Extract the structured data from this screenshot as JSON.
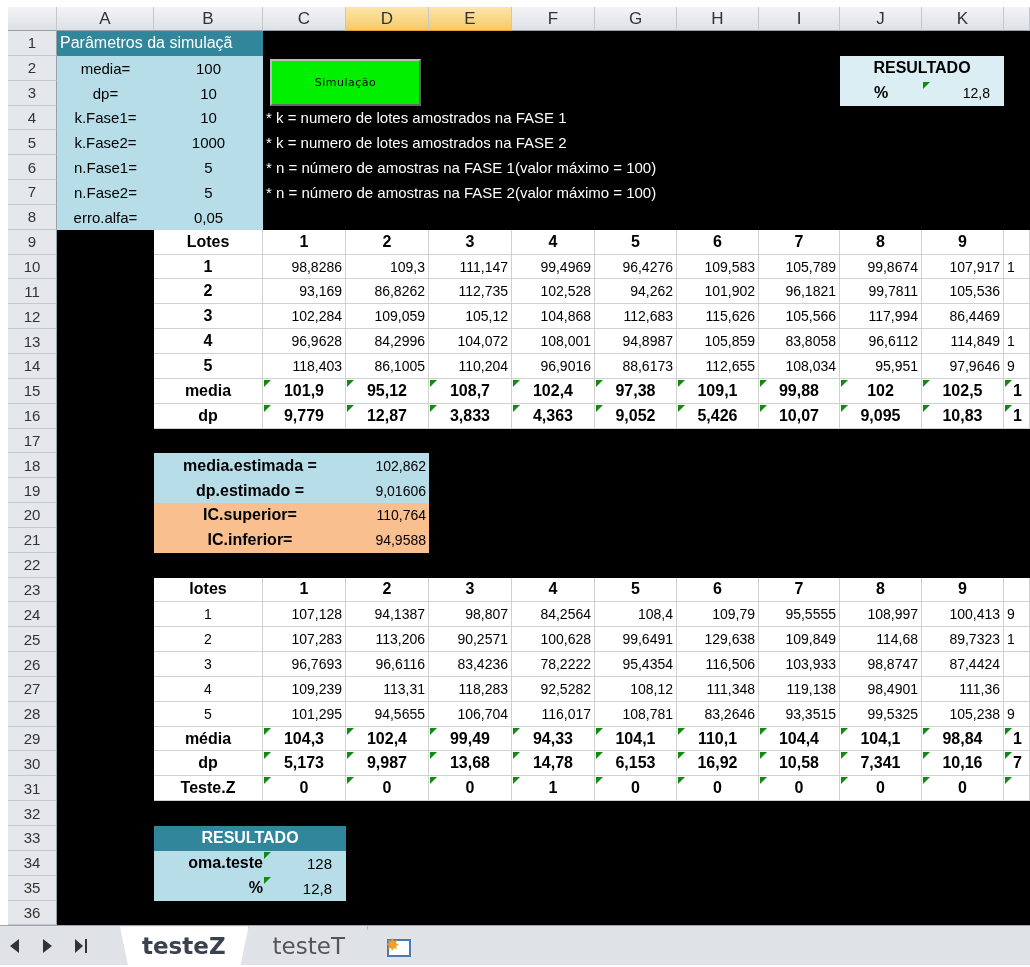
{
  "column_headers": [
    {
      "label": "A",
      "selected": false
    },
    {
      "label": "B",
      "selected": false
    },
    {
      "label": "C",
      "selected": false
    },
    {
      "label": "D",
      "selected": true
    },
    {
      "label": "E",
      "selected": true
    },
    {
      "label": "F",
      "selected": false
    },
    {
      "label": "G",
      "selected": false
    },
    {
      "label": "H",
      "selected": false
    },
    {
      "label": "I",
      "selected": false
    },
    {
      "label": "J",
      "selected": false
    },
    {
      "label": "K",
      "selected": false
    }
  ],
  "row_numbers": [
    "1",
    "2",
    "3",
    "4",
    "5",
    "6",
    "7",
    "8",
    "9",
    "10",
    "11",
    "12",
    "13",
    "14",
    "15",
    "16",
    "17",
    "18",
    "19",
    "20",
    "21",
    "22",
    "23",
    "24",
    "25",
    "26",
    "27",
    "28",
    "29",
    "30",
    "31",
    "32",
    "33",
    "34",
    "35",
    "36"
  ],
  "parameters": {
    "title": "Parâmetros da simulaçã",
    "items": [
      {
        "label": "media=",
        "value": "100"
      },
      {
        "label": "dp=",
        "value": "10"
      },
      {
        "label": "k.Fase1=",
        "value": "10"
      },
      {
        "label": "k.Fase2=",
        "value": "1000"
      },
      {
        "label": "n.Fase1=",
        "value": "5"
      },
      {
        "label": "n.Fase2=",
        "value": "5"
      },
      {
        "label": "erro.alfa=",
        "value": "0,05"
      }
    ]
  },
  "simulate_button": {
    "label": "Simulação"
  },
  "notes": [
    "* k = numero de lotes amostrados na FASE 1",
    "* k = numero de lotes amostrados na FASE 2",
    "* n = número de amostras na FASE 1(valor máximo = 100)",
    "* n = número de amostras na FASE 2(valor máximo = 100)"
  ],
  "result_top": {
    "title": "RESULTADO",
    "label": "%",
    "value": "12,8",
    "flagged": true
  },
  "phase1_table": {
    "header": "Lotes",
    "labels_bold": true,
    "columns": [
      "1",
      "2",
      "3",
      "4",
      "5",
      "6",
      "7",
      "8",
      "9"
    ],
    "rows": [
      {
        "label": "1",
        "kind": "sample",
        "flagged": false,
        "values": [
          "98,8286",
          "109,3",
          "111,147",
          "99,4969",
          "96,4276",
          "109,583",
          "105,789",
          "99,8674",
          "107,917"
        ],
        "cut_off": "1"
      },
      {
        "label": "2",
        "kind": "sample",
        "flagged": false,
        "values": [
          "93,169",
          "86,8262",
          "112,735",
          "102,528",
          "94,262",
          "101,902",
          "96,1821",
          "99,7811",
          "105,536"
        ]
      },
      {
        "label": "3",
        "kind": "sample",
        "flagged": false,
        "values": [
          "102,284",
          "109,059",
          "105,12",
          "104,868",
          "112,683",
          "115,626",
          "105,566",
          "117,994",
          "86,4469"
        ]
      },
      {
        "label": "4",
        "kind": "sample",
        "flagged": false,
        "values": [
          "96,9628",
          "84,2996",
          "104,072",
          "108,001",
          "94,8987",
          "105,859",
          "83,8058",
          "96,6112",
          "114,849"
        ],
        "cut_off": "1"
      },
      {
        "label": "5",
        "kind": "sample",
        "flagged": false,
        "values": [
          "118,403",
          "86,1005",
          "110,204",
          "96,9016",
          "88,6173",
          "112,655",
          "108,034",
          "95,951",
          "97,9646"
        ],
        "cut_off": "9"
      },
      {
        "label": "media",
        "kind": "summary",
        "flagged": true,
        "values": [
          "101,9",
          "95,12",
          "108,7",
          "102,4",
          "97,38",
          "109,1",
          "99,88",
          "102",
          "102,5"
        ],
        "cut_off": "1"
      },
      {
        "label": "dp",
        "kind": "summary",
        "flagged": true,
        "values": [
          "9,779",
          "12,87",
          "3,833",
          "4,363",
          "9,052",
          "5,426",
          "10,07",
          "9,095",
          "10,83"
        ],
        "cut_off": "1"
      }
    ]
  },
  "estimates": [
    {
      "label": "media.estimada =",
      "value": "102,862",
      "color": "#b7dde8"
    },
    {
      "label": "dp.estimado =",
      "value": "9,01606",
      "color": "#b7dde8"
    },
    {
      "label": "IC.superior=",
      "value": "110,764",
      "color": "#fabf8f"
    },
    {
      "label": "IC.inferior=",
      "value": "94,9588",
      "color": "#fabf8f"
    }
  ],
  "phase2_table": {
    "header": "lotes",
    "labels_bold": false,
    "columns": [
      "1",
      "2",
      "3",
      "4",
      "5",
      "6",
      "7",
      "8",
      "9"
    ],
    "rows": [
      {
        "label": "1",
        "kind": "sample",
        "flagged": false,
        "values": [
          "107,128",
          "94,1387",
          "98,807",
          "84,2564",
          "108,4",
          "109,79",
          "95,5555",
          "108,997",
          "100,413"
        ],
        "cut_off": "9"
      },
      {
        "label": "2",
        "kind": "sample",
        "flagged": false,
        "values": [
          "107,283",
          "113,206",
          "90,2571",
          "100,628",
          "99,6491",
          "129,638",
          "109,849",
          "114,68",
          "89,7323"
        ],
        "cut_off": "1"
      },
      {
        "label": "3",
        "kind": "sample",
        "flagged": false,
        "values": [
          "96,7693",
          "96,6116",
          "83,4236",
          "78,2222",
          "95,4354",
          "116,506",
          "103,933",
          "98,8747",
          "87,4424"
        ]
      },
      {
        "label": "4",
        "kind": "sample",
        "flagged": false,
        "values": [
          "109,239",
          "113,31",
          "118,283",
          "92,5282",
          "108,12",
          "111,348",
          "119,138",
          "98,4901",
          "111,36"
        ]
      },
      {
        "label": "5",
        "kind": "sample",
        "flagged": false,
        "values": [
          "101,295",
          "94,5655",
          "106,704",
          "116,017",
          "108,781",
          "83,2646",
          "93,3515",
          "99,5325",
          "105,238"
        ],
        "cut_off": "9"
      },
      {
        "label": "média",
        "kind": "summary",
        "flagged": true,
        "values": [
          "104,3",
          "102,4",
          "99,49",
          "94,33",
          "104,1",
          "110,1",
          "104,4",
          "104,1",
          "98,84"
        ],
        "cut_off": "1"
      },
      {
        "label": "dp",
        "kind": "summary",
        "flagged": true,
        "values": [
          "5,173",
          "9,987",
          "13,68",
          "14,78",
          "6,153",
          "16,92",
          "10,58",
          "7,341",
          "10,16"
        ],
        "cut_off": "7"
      },
      {
        "label": "Teste.Z",
        "kind": "summary",
        "flagged": true,
        "values": [
          "0",
          "0",
          "0",
          "1",
          "0",
          "0",
          "0",
          "0",
          "0"
        ]
      }
    ]
  },
  "result_bottom": {
    "title": "RESULTADO",
    "rows": [
      {
        "label": "oma.teste",
        "value": "128",
        "flagged": true
      },
      {
        "label": "%",
        "value": "12,8",
        "flagged": true
      }
    ]
  },
  "sheet_tabs": [
    {
      "label": "testeZ",
      "selected": true
    },
    {
      "label": "testeT",
      "selected": false
    }
  ]
}
